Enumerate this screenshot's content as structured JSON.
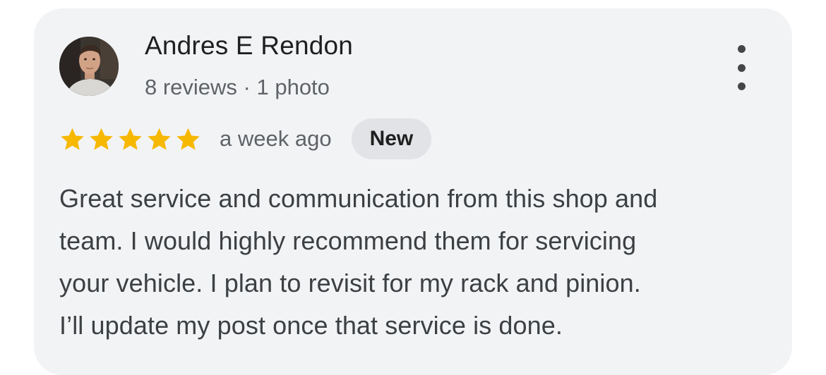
{
  "reviewer": {
    "name": "Andres E Rendon",
    "meta": "8 reviews · 1 photo",
    "avatar_icon": "profile-photo"
  },
  "rating": {
    "stars": 5,
    "max_stars": 5,
    "star_color": "#f6b800",
    "date": "a week ago",
    "badge": "New"
  },
  "review": {
    "lines": [
      "Great service and communication from this shop and",
      "team. I would highly recommend them for servicing",
      "your vehicle. I plan to revisit for my rack and pinion.",
      "I’ll update my post once that service is done."
    ]
  },
  "more_menu_icon": "more-vert-icon"
}
